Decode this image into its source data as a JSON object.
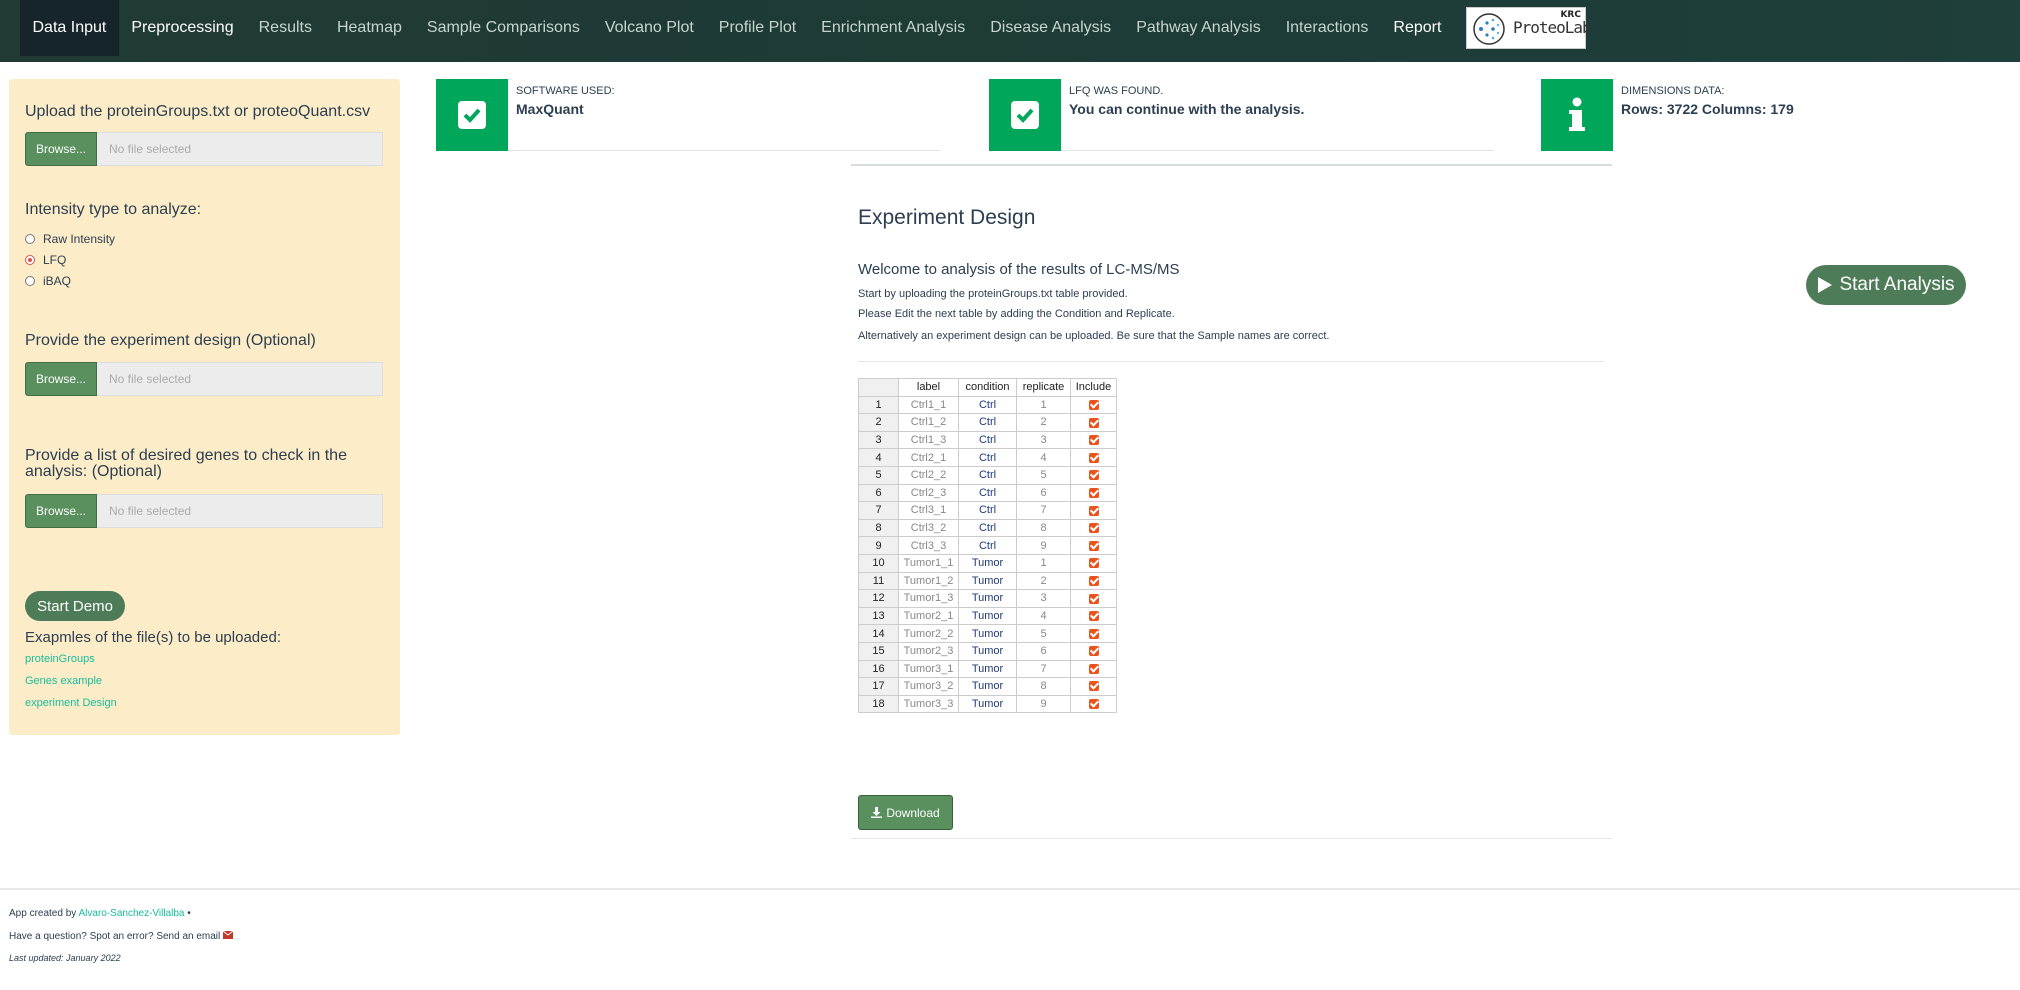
{
  "nav": {
    "items": [
      "Data Input",
      "Preprocessing",
      "Results",
      "Heatmap",
      "Sample Comparisons",
      "Volcano Plot",
      "Profile Plot",
      "Enrichment Analysis",
      "Disease Analysis",
      "Pathway Analysis",
      "Interactions",
      "Report"
    ],
    "active": "Data Input",
    "logo_text": "ProteoLab",
    "logo_badge": "KRC"
  },
  "sidebar": {
    "upload_label": "Upload the proteinGroups.txt or proteoQuant.csv",
    "browse_label": "Browse...",
    "no_file": "No file selected",
    "intensity_label": "Intensity type to analyze:",
    "intensity_options": [
      "Raw Intensity",
      "LFQ",
      "iBAQ"
    ],
    "intensity_selected": "LFQ",
    "design_label": "Provide the experiment design (Optional)",
    "genes_label": "Provide a list of desired genes to check in the analysis: (Optional)",
    "demo_button": "Start Demo",
    "examples_label": "Exapmles of the file(s) to be uploaded:",
    "example_links": [
      "proteinGroups",
      "Genes example",
      "experiment Design"
    ]
  },
  "info_boxes": [
    {
      "caption": "SOFTWARE USED:",
      "value": "MaxQuant",
      "icon": "check-icon"
    },
    {
      "caption": "LFQ WAS FOUND.",
      "value": "You can continue with the analysis.",
      "icon": "check-icon"
    },
    {
      "caption": "DIMENSIONS DATA:",
      "value": "Rows: 3722 Columns: 179",
      "icon": "info-icon"
    }
  ],
  "main": {
    "title": "Experiment Design",
    "subtitle": "Welcome to analysis of the results of LC-MS/MS",
    "paragraphs": [
      "Start by uploading the proteinGroups.txt table provided.",
      "Please Edit the next table by adding the Condition and Replicate.",
      "Alternatively an experiment design can be uploaded. Be sure that the Sample names are correct."
    ],
    "start_analysis": "Start Analysis",
    "download_label": "Download"
  },
  "table": {
    "headers": [
      "",
      "label",
      "condition",
      "replicate",
      "Include"
    ],
    "rows": [
      [
        "1",
        "Ctrl1_1",
        "Ctrl",
        "1"
      ],
      [
        "2",
        "Ctrl1_2",
        "Ctrl",
        "2"
      ],
      [
        "3",
        "Ctrl1_3",
        "Ctrl",
        "3"
      ],
      [
        "4",
        "Ctrl2_1",
        "Ctrl",
        "4"
      ],
      [
        "5",
        "Ctrl2_2",
        "Ctrl",
        "5"
      ],
      [
        "6",
        "Ctrl2_3",
        "Ctrl",
        "6"
      ],
      [
        "7",
        "Ctrl3_1",
        "Ctrl",
        "7"
      ],
      [
        "8",
        "Ctrl3_2",
        "Ctrl",
        "8"
      ],
      [
        "9",
        "Ctrl3_3",
        "Ctrl",
        "9"
      ],
      [
        "10",
        "Tumor1_1",
        "Tumor",
        "1"
      ],
      [
        "11",
        "Tumor1_2",
        "Tumor",
        "2"
      ],
      [
        "12",
        "Tumor1_3",
        "Tumor",
        "3"
      ],
      [
        "13",
        "Tumor2_1",
        "Tumor",
        "4"
      ],
      [
        "14",
        "Tumor2_2",
        "Tumor",
        "5"
      ],
      [
        "15",
        "Tumor2_3",
        "Tumor",
        "6"
      ],
      [
        "16",
        "Tumor3_1",
        "Tumor",
        "7"
      ],
      [
        "17",
        "Tumor3_2",
        "Tumor",
        "8"
      ],
      [
        "18",
        "Tumor3_3",
        "Tumor",
        "9"
      ]
    ],
    "include_all": true
  },
  "footer": {
    "created_prefix": "App created by",
    "author": "Alvaro-Sanchez-Villalba",
    "question": "Have a question? Spot an error? Send an email",
    "updated": "Last updated: January 2022"
  },
  "colors": {
    "navbar": "#1f3b36",
    "sidebar_bg": "#fcedc8",
    "info_green": "#00a65a",
    "button_green": "#5a8f5e",
    "link": "#18bc9c",
    "checkbox": "#e8541c"
  }
}
